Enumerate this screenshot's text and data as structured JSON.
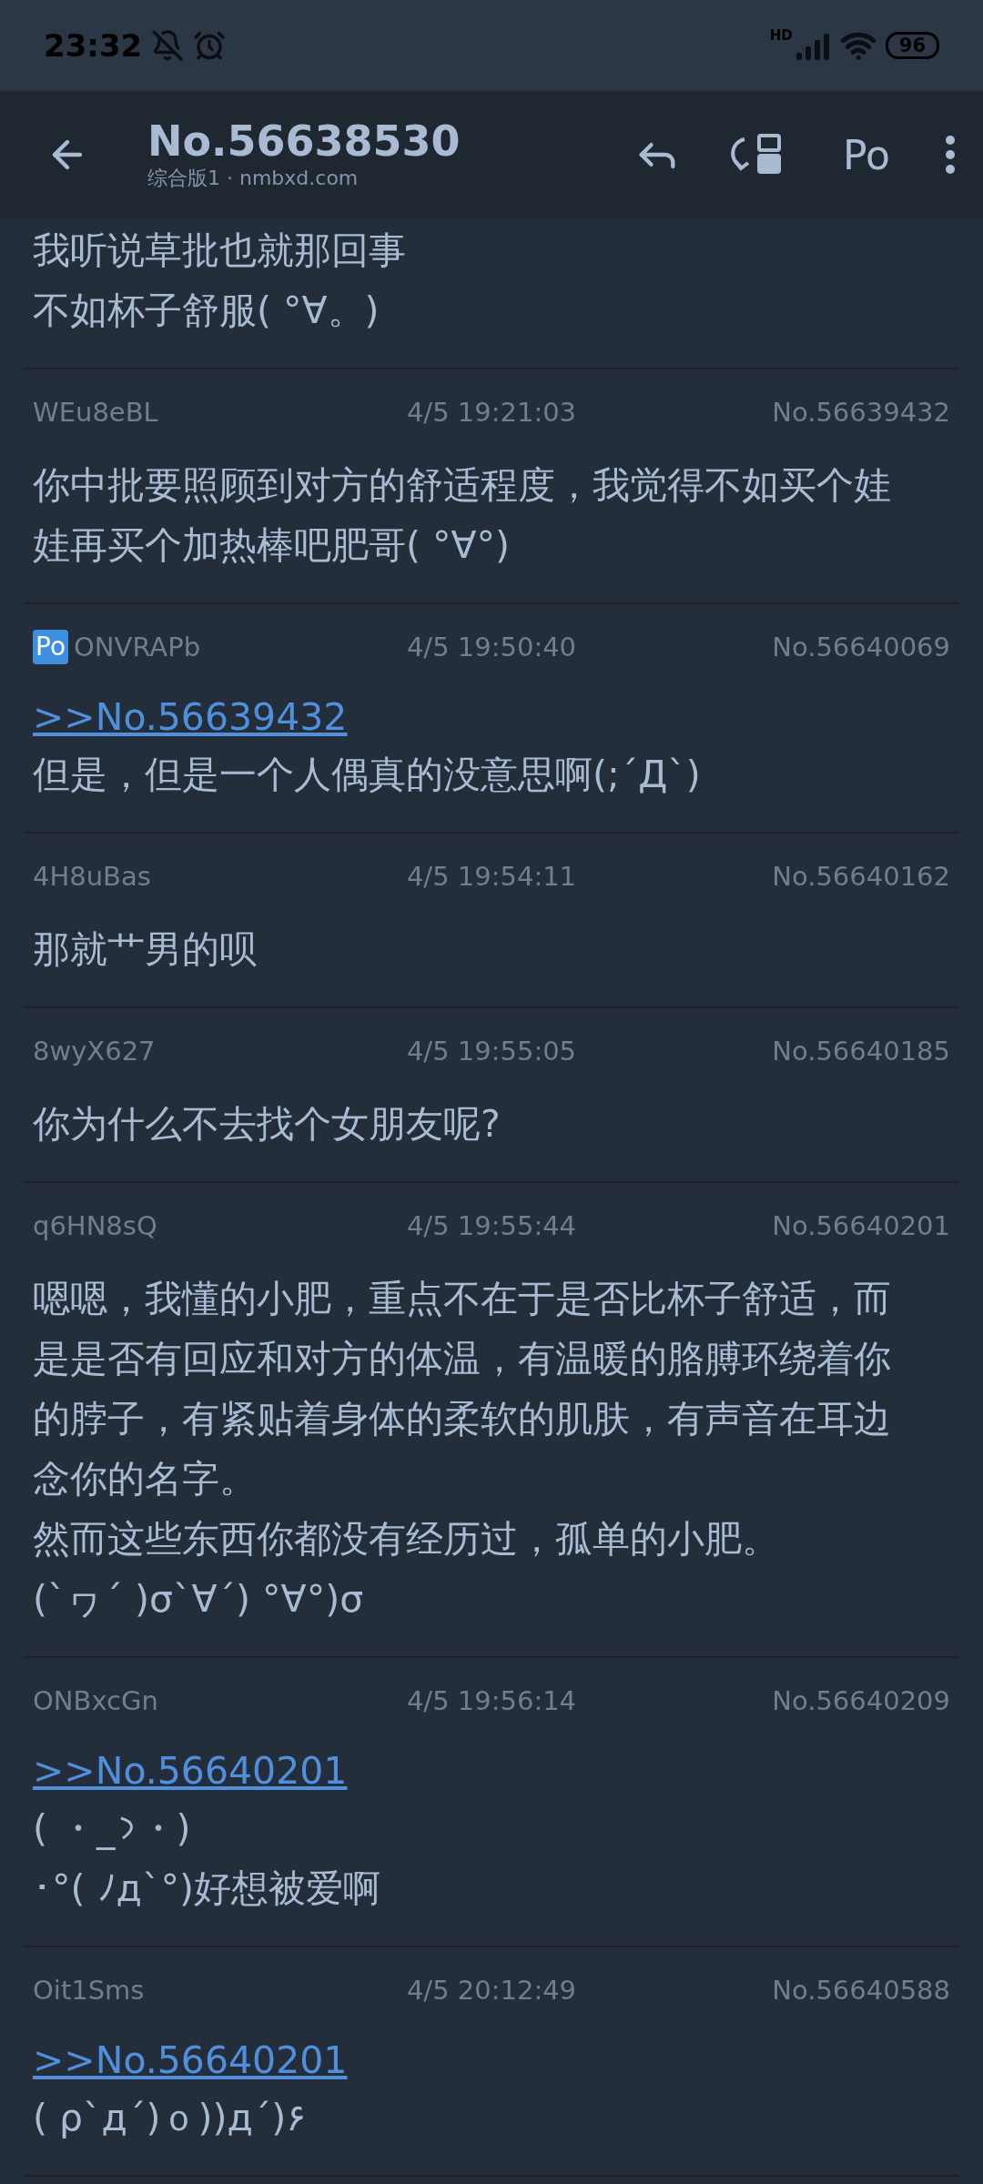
{
  "status_bar": {
    "time": "23:32",
    "network": "HD",
    "battery": "96"
  },
  "app_bar": {
    "title": "No.56638530",
    "subtitle": "综合版1 · nmbxd.com",
    "po_button": "Po"
  },
  "posts": [
    {
      "body": [
        {
          "kind": "text",
          "text": "我听说草批也就那回事"
        },
        {
          "kind": "text",
          "text": "不如杯子舒服( °∀。)"
        }
      ]
    },
    {
      "uid": "WEu8eBL",
      "po": false,
      "time": "4/5 19:21:03",
      "number": "No.56639432",
      "body": [
        {
          "kind": "text",
          "text": "你中批要照顾到对方的舒适程度，我觉得不如买个娃娃再买个加热棒吧肥哥( °∀°)"
        }
      ]
    },
    {
      "uid": "ONVRAPb",
      "po": true,
      "po_badge": "Po",
      "time": "4/5 19:50:40",
      "number": "No.56640069",
      "body": [
        {
          "kind": "quote",
          "text": ">>No.56639432"
        },
        {
          "kind": "text",
          "text": "但是，但是一个人偶真的没意思啊(;´Д`)"
        }
      ]
    },
    {
      "uid": "4H8uBas",
      "po": false,
      "time": "4/5 19:54:11",
      "number": "No.56640162",
      "body": [
        {
          "kind": "text",
          "text": "那就艹男的呗"
        }
      ]
    },
    {
      "uid": "8wyX627",
      "po": false,
      "time": "4/5 19:55:05",
      "number": "No.56640185",
      "body": [
        {
          "kind": "text",
          "text": "你为什么不去找个女朋友呢?"
        }
      ]
    },
    {
      "uid": "q6HN8sQ",
      "po": false,
      "time": "4/5 19:55:44",
      "number": "No.56640201",
      "body": [
        {
          "kind": "text",
          "text": "嗯嗯，我懂的小肥，重点不在于是否比杯子舒适，而是是否有回应和对方的体温，有温暖的胳膊环绕着你的脖子，有紧贴着身体的柔软的肌肤，有声音在耳边念你的名字。"
        },
        {
          "kind": "text",
          "text": "然而这些东西你都没有经历过，孤单的小肥。"
        },
        {
          "kind": "text",
          "text": "(`ヮ´ )σ`∀´) °∀°)σ"
        }
      ]
    },
    {
      "uid": "ONBxcGn",
      "po": false,
      "time": "4/5 19:56:14",
      "number": "No.56640209",
      "body": [
        {
          "kind": "quote",
          "text": ">>No.56640201"
        },
        {
          "kind": "line",
          "parts": [
            {
              "kind": "text",
              "text": "( ・_"
            },
            {
              "kind": "hook"
            },
            {
              "kind": "text",
              "text": "・)"
            }
          ]
        },
        {
          "kind": "text",
          "text": "･°( ﾉд`°)好想被爱啊"
        }
      ]
    },
    {
      "uid": "Oit1Sms",
      "po": false,
      "time": "4/5 20:12:49",
      "number": "No.56640588",
      "body": [
        {
          "kind": "quote",
          "text": ">>No.56640201"
        },
        {
          "kind": "text",
          "text": "( ρ`д´)ｏ))д´)۶"
        }
      ]
    }
  ]
}
